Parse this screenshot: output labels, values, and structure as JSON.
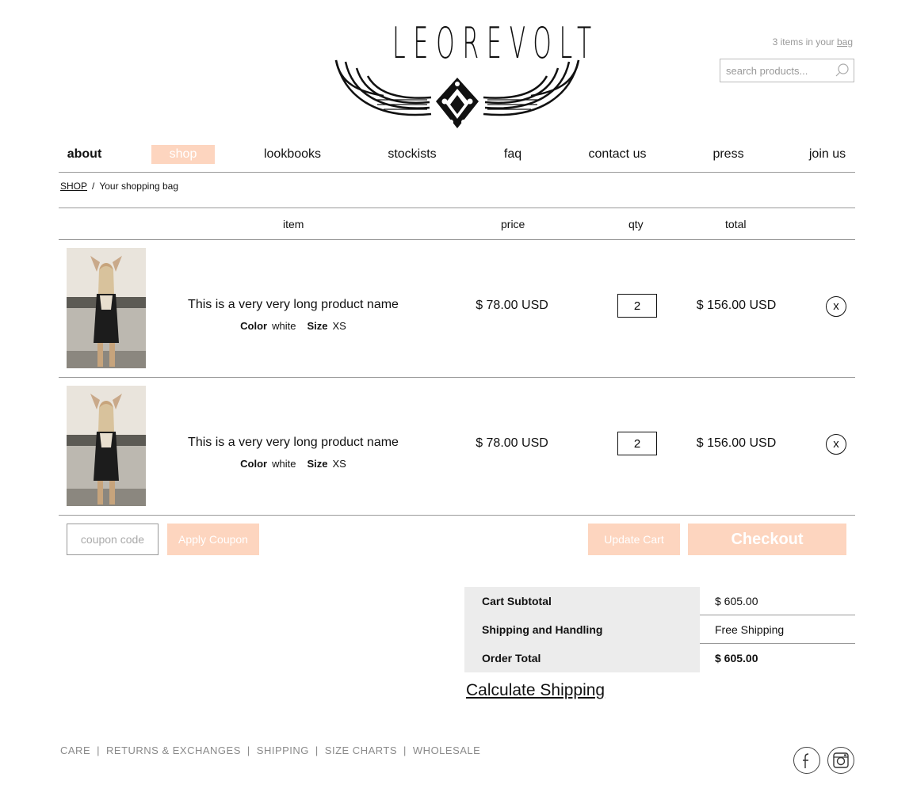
{
  "header": {
    "logo_text": "LEOREVOLT",
    "bag_count_text": "3 items in your",
    "bag_link": "bag",
    "search_placeholder": "search products..."
  },
  "nav": {
    "items": [
      {
        "label": "about",
        "active": false
      },
      {
        "label": "shop",
        "active": true
      },
      {
        "label": "lookbooks",
        "active": false
      },
      {
        "label": "stockists",
        "active": false
      },
      {
        "label": "faq",
        "active": false
      },
      {
        "label": "contact us",
        "active": false
      },
      {
        "label": "press",
        "active": false
      },
      {
        "label": "join us",
        "active": false
      }
    ]
  },
  "breadcrumb": {
    "root": "SHOP",
    "separator": "/",
    "current": "Your shopping bag"
  },
  "table": {
    "headers": {
      "item": "item",
      "price": "price",
      "qty": "qty",
      "total": "total"
    },
    "rows": [
      {
        "name": "This is a very very long product name",
        "color_label": "Color",
        "color": "white",
        "size_label": "Size",
        "size": "XS",
        "price": "$ 78.00 USD",
        "qty": "2",
        "total": "$ 156.00 USD",
        "remove": "x"
      },
      {
        "name": "This is a very very long product name",
        "color_label": "Color",
        "color": "white",
        "size_label": "Size",
        "size": "XS",
        "price": "$ 78.00 USD",
        "qty": "2",
        "total": "$ 156.00 USD",
        "remove": "x"
      }
    ]
  },
  "actions": {
    "coupon_placeholder": "coupon code",
    "apply_coupon": "Apply Coupon",
    "update_cart": "Update Cart",
    "checkout": "Checkout"
  },
  "totals": {
    "subtotal_label": "Cart Subtotal",
    "subtotal_value": "$ 605.00",
    "shipping_label": "Shipping and Handling",
    "shipping_value": "Free Shipping",
    "order_total_label": "Order Total",
    "order_total_value": "$ 605.00",
    "calculate_shipping": "Calculate Shipping"
  },
  "footer": {
    "links": [
      "CARE",
      "RETURNS & EXCHANGES",
      "SHIPPING",
      "SIZE CHARTS",
      "WHOLESALE"
    ],
    "separator": "|",
    "social": [
      "facebook-icon",
      "instagram-icon"
    ]
  },
  "colors": {
    "accent": "#fdd5bf",
    "rule": "#9a9a9a",
    "total_label_bg": "#ececec"
  }
}
